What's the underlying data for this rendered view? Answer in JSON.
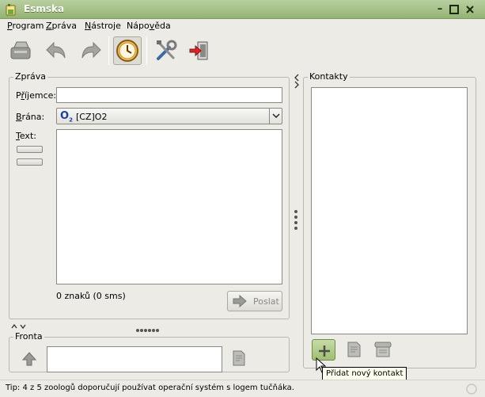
{
  "window": {
    "title": "Esmska",
    "controls": [
      "minimize-icon",
      "maximize-icon",
      "close-icon"
    ]
  },
  "menu": {
    "items": [
      {
        "pre": "",
        "u": "P",
        "post": "rogram"
      },
      {
        "pre": "",
        "u": "Z",
        "post": "práva"
      },
      {
        "pre": "",
        "u": "N",
        "post": "ástroje"
      },
      {
        "pre": "Nápo",
        "u": "v",
        "post": "ěda"
      }
    ]
  },
  "toolbar": {
    "icons": [
      "compose-icon",
      "undo-icon",
      "redo-icon",
      "history-clock-icon",
      "tools-icon",
      "exit-icon"
    ]
  },
  "message": {
    "group_title": "Zpráva",
    "recipient_label": {
      "pre": "P",
      "u": "ř",
      "post": "íjemce:"
    },
    "recipient_value": "",
    "gateway_label": {
      "pre": "",
      "u": "B",
      "post": "rána:"
    },
    "gateway_value": "[CZ]O2",
    "gateway_logo": "O",
    "gateway_logo_sub": "2",
    "text_label": {
      "pre": "",
      "u": "T",
      "post": "ext:"
    },
    "text_value": "",
    "counter": "0 znaků (0 sms)",
    "send_label": "Poslat"
  },
  "queue": {
    "group_title": "Fronta"
  },
  "contacts": {
    "group_title": "Kontakty",
    "tooltip": "Přidat nový kontakt"
  },
  "status": {
    "tip": "Tip: 4 z 5 zoologů doporučují používat operační systém s logem tučňáka."
  },
  "colors": {
    "titlebar": "#a3bf85",
    "window_bg": "#ecebe6",
    "add_button": "#9fbf72"
  }
}
